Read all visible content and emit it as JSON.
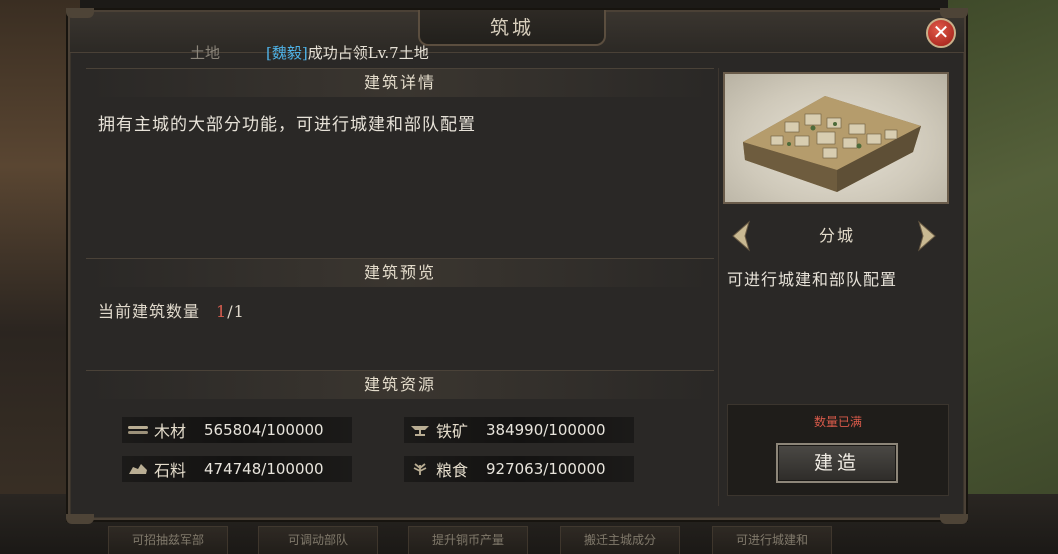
{
  "title": "筑城",
  "close_label": "✕",
  "notice": {
    "faded_prefix": "土地",
    "faction": "[魏毅]",
    "message": "成功占领Lv.7土地"
  },
  "sections": {
    "details": {
      "header": "建筑详情",
      "description": "拥有主城的大部分功能，可进行城建和部队配置"
    },
    "preview": {
      "header": "建筑预览",
      "count_label": "当前建筑数量",
      "count_current": "1",
      "count_max": "/1"
    },
    "resources": {
      "header": "建筑资源",
      "items": [
        {
          "icon": "wood-icon",
          "label": "木材",
          "value": "565804/100000"
        },
        {
          "icon": "iron-icon",
          "label": "铁矿",
          "value": "384990/100000"
        },
        {
          "icon": "stone-icon",
          "label": "石料",
          "value": "474748/100000"
        },
        {
          "icon": "grain-icon",
          "label": "粮食",
          "value": "927063/100000"
        }
      ]
    }
  },
  "building": {
    "name": "分城",
    "description": "可进行城建和部队配置",
    "status": "数量已满",
    "build_label": "建造"
  },
  "background_tabs": [
    "可招抽兹军部",
    "可调动部队",
    "提升铜币产量",
    "搬迁主城成分",
    "可进行城建和"
  ],
  "colors": {
    "faction": "#4fb2e6",
    "warning": "#d85a4a",
    "count_current": "#d65c4e"
  }
}
